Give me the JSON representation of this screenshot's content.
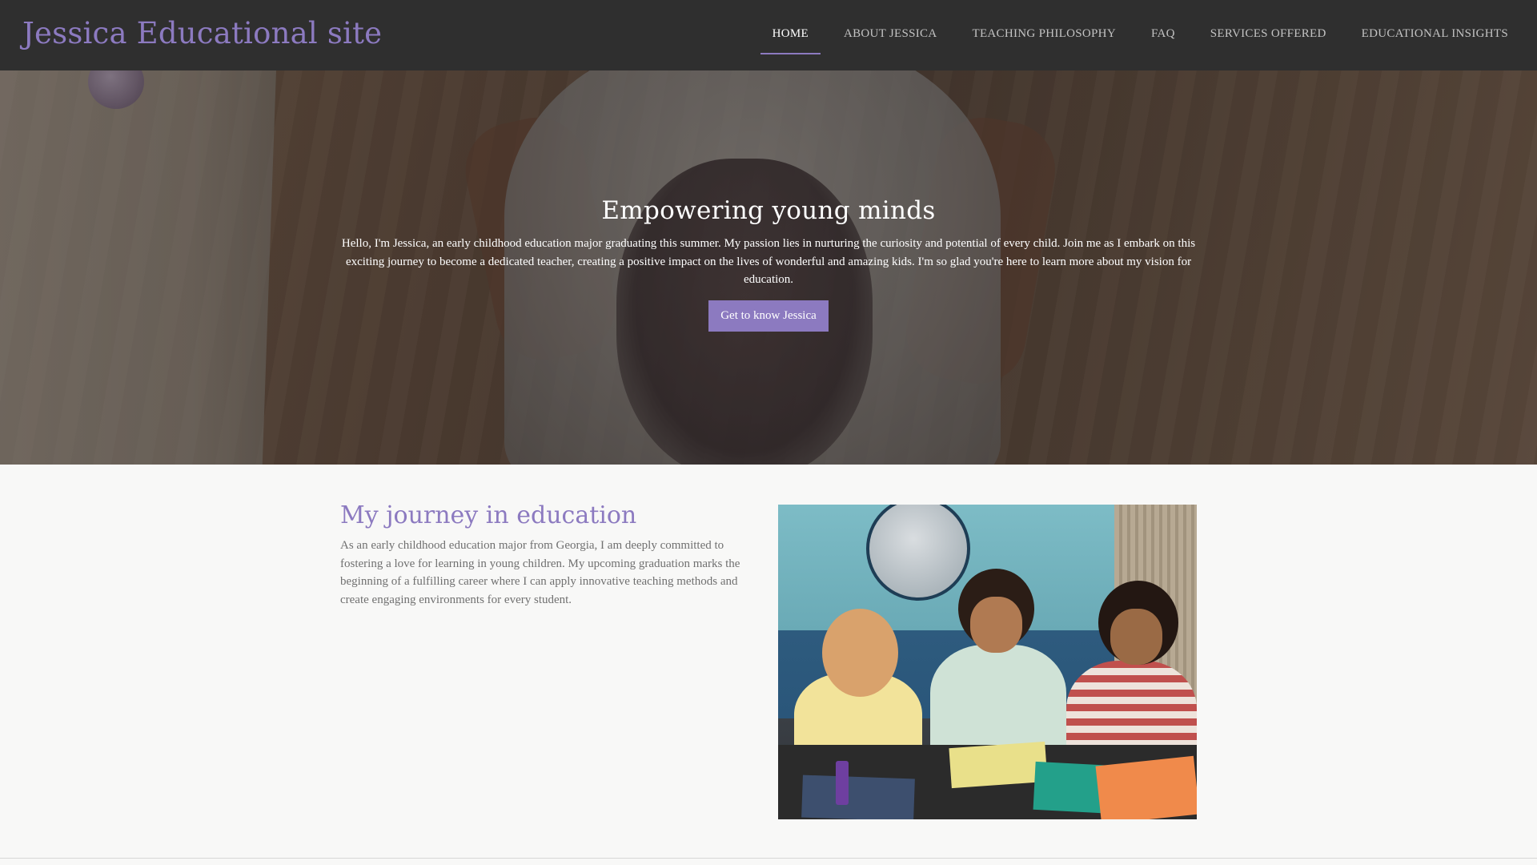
{
  "site": {
    "title": "Jessica Educational site"
  },
  "nav": {
    "items": [
      {
        "label": "HOME",
        "active": true
      },
      {
        "label": "ABOUT JESSICA",
        "active": false
      },
      {
        "label": "TEACHING PHILOSOPHY",
        "active": false
      },
      {
        "label": "FAQ",
        "active": false
      },
      {
        "label": "SERVICES OFFERED",
        "active": false
      },
      {
        "label": "EDUCATIONAL INSIGHTS",
        "active": false
      }
    ]
  },
  "hero": {
    "title": "Empowering young minds",
    "text": "Hello, I'm Jessica, an early childhood education major graduating this summer. My passion lies in nurturing the curiosity and potential of every child. Join me as I embark on this exciting journey to become a dedicated teacher, creating a positive impact on the lives of wonderful and amazing kids. I'm so glad you're here to learn more about my vision for education.",
    "button_label": "Get to know Jessica"
  },
  "journey": {
    "title": "My journey in education",
    "text": "As an early childhood education major from Georgia, I am deeply committed to fostering a love for learning in young children. My upcoming graduation marks the beginning of a fulfilling career where I can apply innovative teaching methods and create engaging environments for every student."
  },
  "colors": {
    "accent": "#8c7ac0",
    "header_bg": "#2f2f2f",
    "page_bg": "#f8f8f7",
    "body_text": "#707070"
  }
}
